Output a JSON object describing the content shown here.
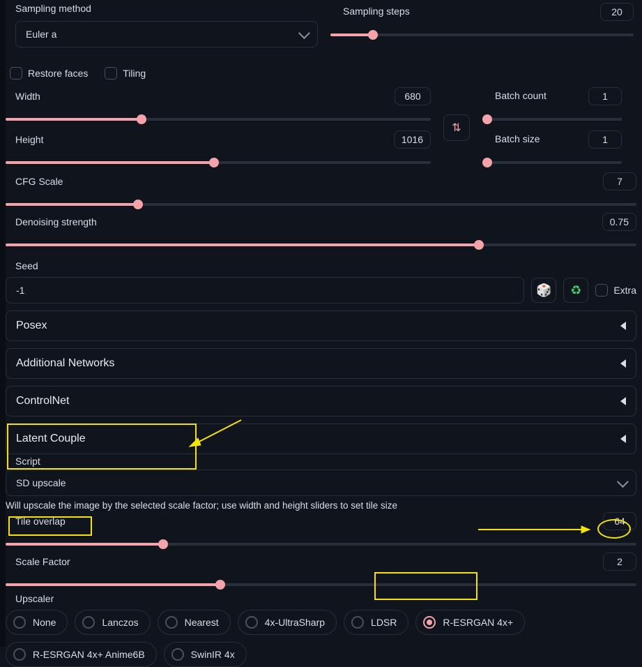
{
  "sampling": {
    "method_label": "Sampling method",
    "method_value": "Euler a",
    "steps_label": "Sampling steps",
    "steps_value": "20"
  },
  "checks": {
    "restore_faces": "Restore faces",
    "tiling": "Tiling"
  },
  "dims": {
    "width_label": "Width",
    "width_value": "680",
    "height_label": "Height",
    "height_value": "1016"
  },
  "batch": {
    "count_label": "Batch count",
    "count_value": "1",
    "size_label": "Batch size",
    "size_value": "1"
  },
  "cfg": {
    "label": "CFG Scale",
    "value": "7"
  },
  "denoise": {
    "label": "Denoising strength",
    "value": "0.75"
  },
  "seed": {
    "label": "Seed",
    "value": "-1",
    "extra_label": "Extra"
  },
  "accordions": {
    "posex": "Posex",
    "additional_networks": "Additional Networks",
    "controlnet": "ControlNet",
    "latent_couple": "Latent Couple"
  },
  "script": {
    "label": "Script",
    "value": "SD upscale",
    "help": "Will upscale the image by the selected scale factor; use width and height sliders to set tile size"
  },
  "tile_overlap": {
    "label": "Tile overlap",
    "value": "64"
  },
  "scale_factor": {
    "label": "Scale Factor",
    "value": "2"
  },
  "upscaler": {
    "label": "Upscaler",
    "options": [
      "None",
      "Lanczos",
      "Nearest",
      "4x-UltraSharp",
      "LDSR",
      "R-ESRGAN 4x+",
      "R-ESRGAN 4x+ Anime6B",
      "SwinIR 4x"
    ],
    "selected": "R-ESRGAN 4x+"
  }
}
